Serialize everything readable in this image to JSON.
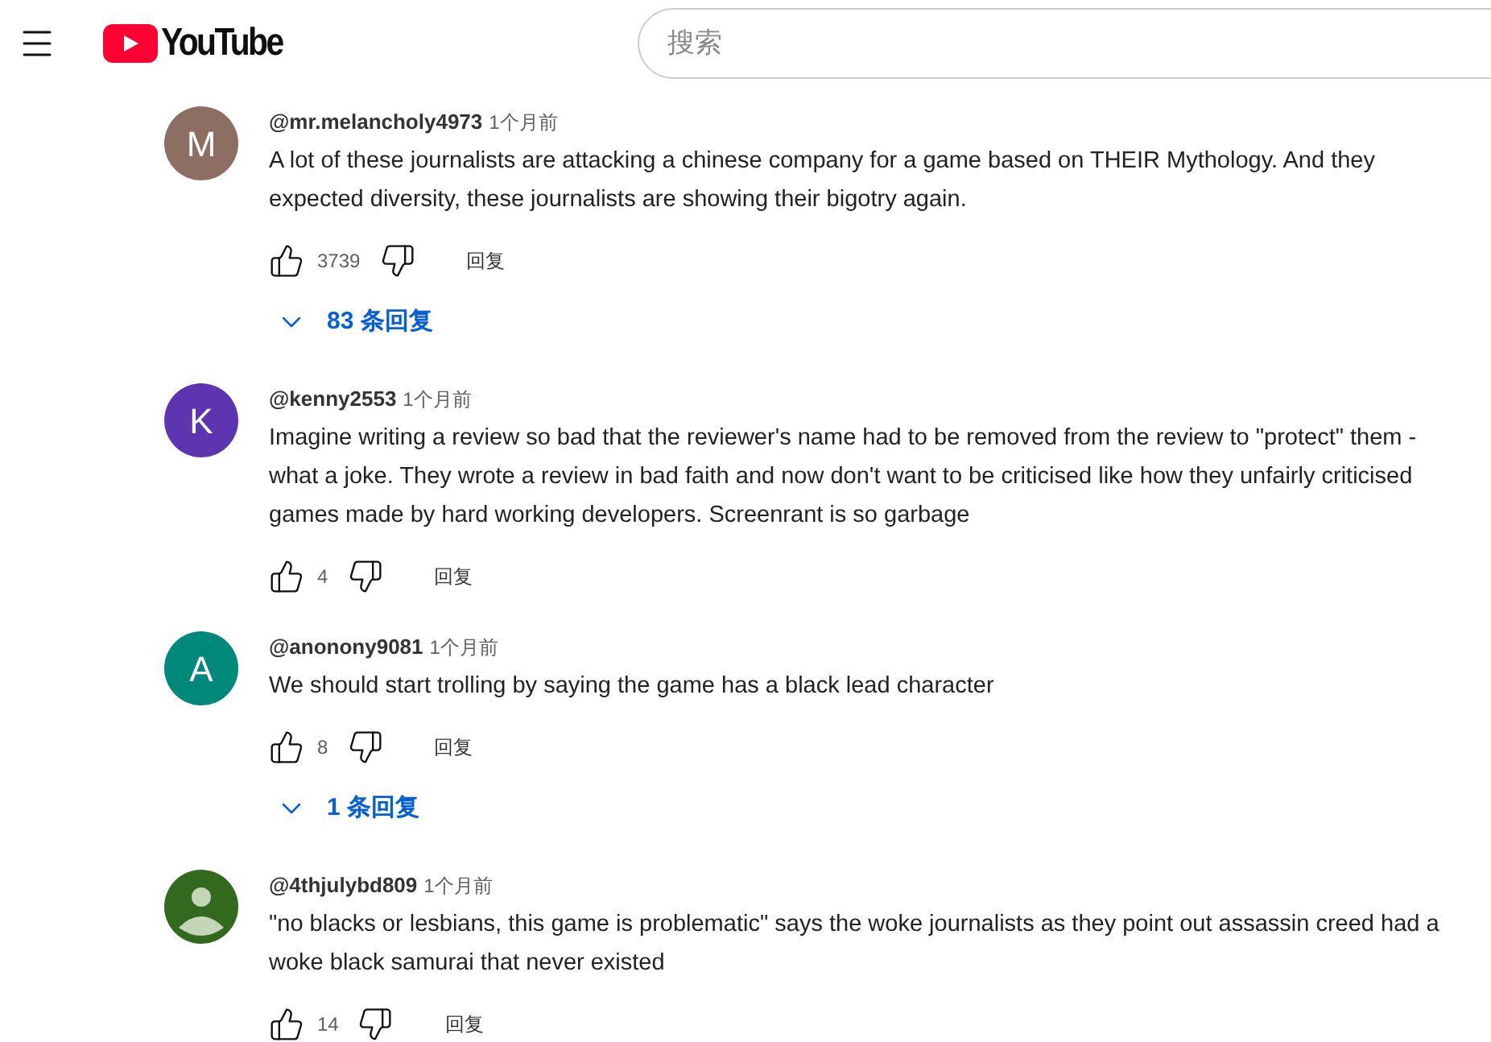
{
  "header": {
    "logo_text": "YouTube",
    "search": {
      "placeholder": "搜索"
    }
  },
  "comments": [
    {
      "avatar": {
        "kind": "letter",
        "letter": "M",
        "color": "#8d6e63"
      },
      "author": "@mr.melancholy4973",
      "time": "1个月前",
      "text": "A lot of these journalists are attacking a chinese company for a game based on THEIR Mythology. And they expected diversity, these journalists are showing their bigotry again.",
      "likes": "3739",
      "reply_label": "回复",
      "replies": "83 条回复"
    },
    {
      "avatar": {
        "kind": "letter",
        "letter": "K",
        "color": "#5e35b1"
      },
      "author": "@kenny2553",
      "time": "1个月前",
      "text": "Imagine writing a review so bad that the reviewer's name had to be removed from the review to \"protect\" them - what a joke. They wrote a review in bad faith and now don't want to be criticised like how they unfairly criticised games made by hard working developers. Screenrant is so garbage",
      "likes": "4",
      "reply_label": "回复"
    },
    {
      "avatar": {
        "kind": "letter",
        "letter": "A",
        "color": "#00897b"
      },
      "author": "@anonony9081",
      "time": "1个月前",
      "text": "We should start trolling by saying the game has a black lead character",
      "likes": "8",
      "reply_label": "回复",
      "replies": "1 条回复"
    },
    {
      "avatar": {
        "kind": "default",
        "color": "#33691e"
      },
      "author": "@4thjulybd809",
      "time": "1个月前",
      "text": "\"no blacks or lesbians, this game is problematic\" says the woke journalists as they point out assassin creed had a woke black samurai that never existed",
      "likes": "14",
      "reply_label": "回复"
    }
  ]
}
